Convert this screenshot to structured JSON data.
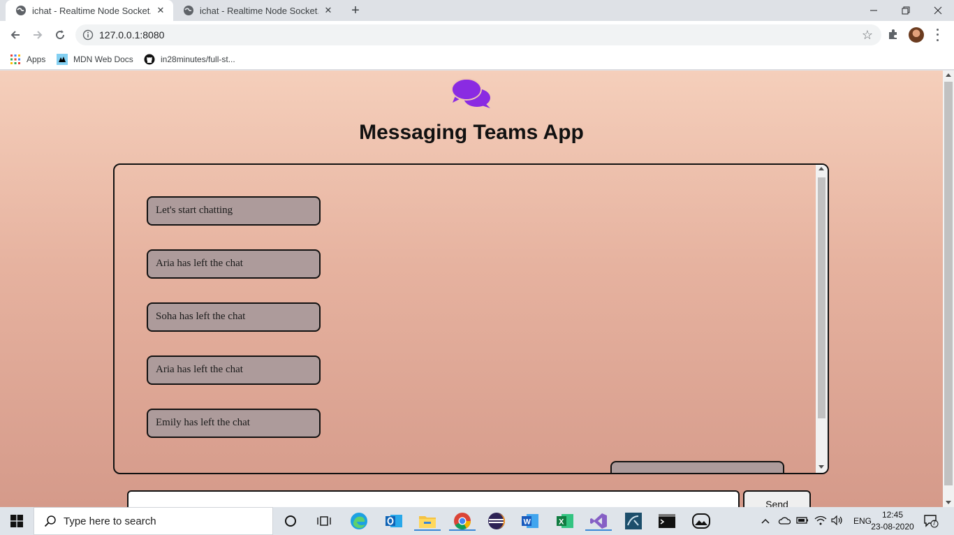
{
  "browser": {
    "tabs": [
      {
        "title": "ichat - Realtime Node Socket.io C",
        "active": true
      },
      {
        "title": "ichat - Realtime Node Socket.io C",
        "active": false
      }
    ],
    "url": "127.0.0.1:8080",
    "bookmarks": [
      {
        "label": "Apps",
        "icon": "apps-grid-icon"
      },
      {
        "label": "MDN Web Docs",
        "icon": "mdn-icon"
      },
      {
        "label": "in28minutes/full-st...",
        "icon": "github-icon"
      }
    ]
  },
  "app": {
    "title": "Messaging Teams App",
    "logo_icon": "chat-bubbles-icon",
    "accent_color": "#8a2be2",
    "messages_left": [
      "Let's start chatting",
      "Aria has left the chat",
      "Soha has left the chat",
      "Aria has left the chat",
      "Emily has left the chat"
    ],
    "input_value": "",
    "send_label": "Send"
  },
  "taskbar": {
    "search_placeholder": "Type here to search",
    "language": "ENG",
    "time": "12:45",
    "date": "23-08-2020",
    "notification_count": "7",
    "apps": [
      "cortana-icon",
      "task-view-icon",
      "edge-icon",
      "outlook-icon",
      "file-explorer-icon",
      "chrome-icon",
      "eclipse-icon",
      "word-icon",
      "excel-icon",
      "visual-studio-icon",
      "mysql-workbench-icon",
      "terminal-icon",
      "photos-icon"
    ]
  }
}
